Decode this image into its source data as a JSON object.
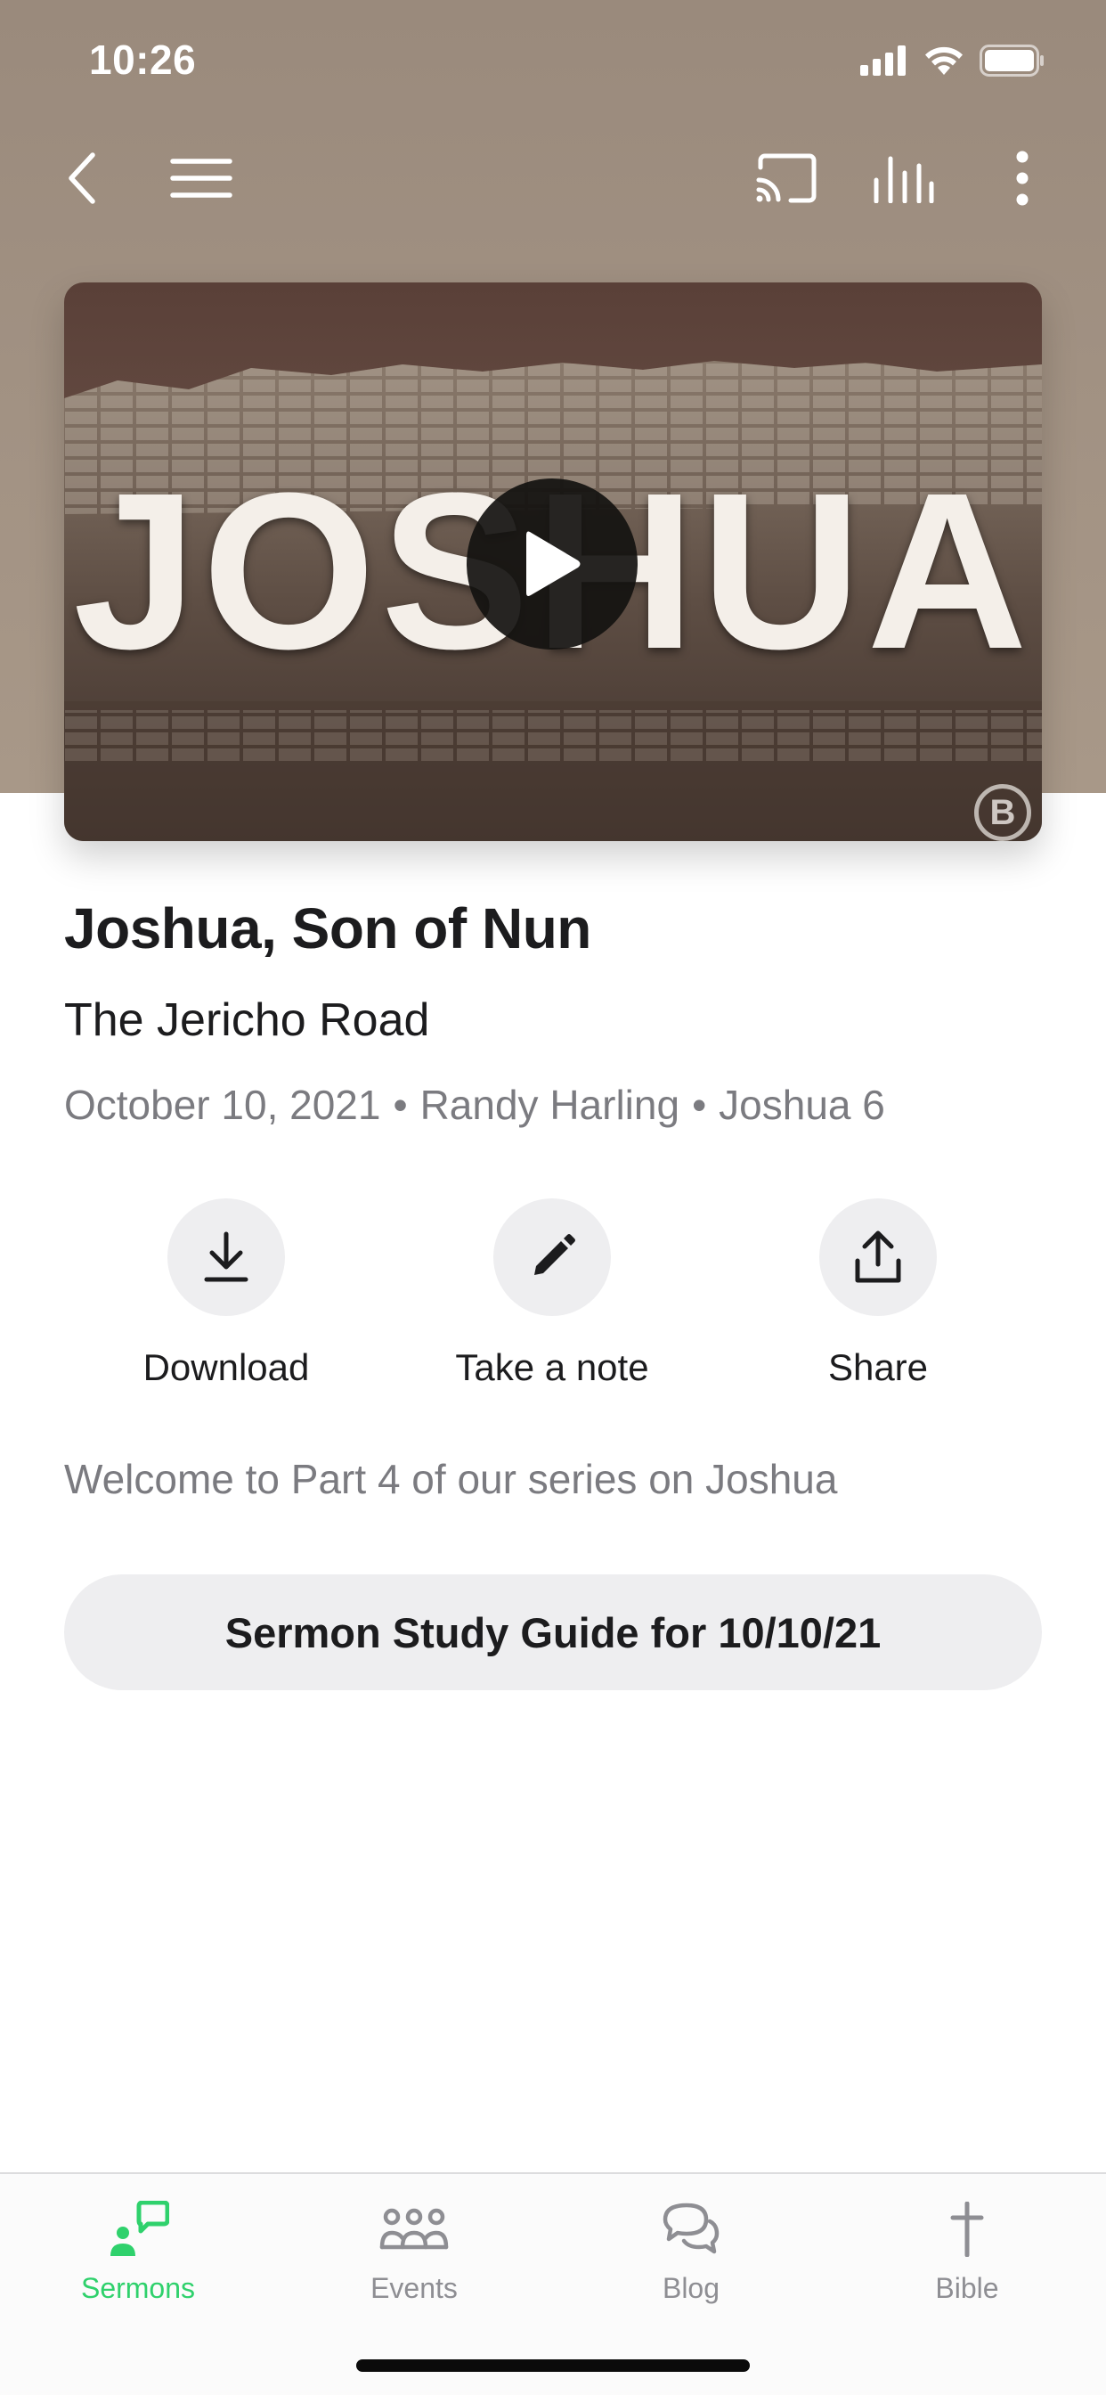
{
  "status_bar": {
    "time": "10:26"
  },
  "toolbar": {
    "back_icon": "chevron-left-icon",
    "menu_icon": "hamburger-menu-icon",
    "cast_icon": "cast-icon",
    "audio_icon": "audio-levels-icon",
    "more_icon": "more-vertical-icon"
  },
  "media": {
    "artwork_text": "JOSHUA",
    "play_icon": "play-icon"
  },
  "sermon": {
    "title": "Joshua, Son of Nun",
    "series": "The Jericho Road",
    "date": "October 10, 2021",
    "speaker": "Randy Harling",
    "passage": "Joshua 6",
    "separator": "•",
    "description": "Welcome to Part 4 of our series on Joshua"
  },
  "actions": [
    {
      "label": "Download",
      "icon": "download-icon"
    },
    {
      "label": "Take a note",
      "icon": "pencil-icon"
    },
    {
      "label": "Share",
      "icon": "share-icon"
    }
  ],
  "study_guide": {
    "label": "Sermon Study Guide for 10/10/21"
  },
  "tabs": [
    {
      "label": "Sermons",
      "icon": "sermons-icon",
      "active": true
    },
    {
      "label": "Events",
      "icon": "events-icon",
      "active": false
    },
    {
      "label": "Blog",
      "icon": "blog-icon",
      "active": false
    },
    {
      "label": "Bible",
      "icon": "bible-cross-icon",
      "active": false
    }
  ],
  "colors": {
    "accent": "#2fd16c",
    "header_bg": "#a39384",
    "inactive_tab": "#8e8e93",
    "secondary_text": "#7b7b80",
    "button_bg": "#eeeef0"
  }
}
